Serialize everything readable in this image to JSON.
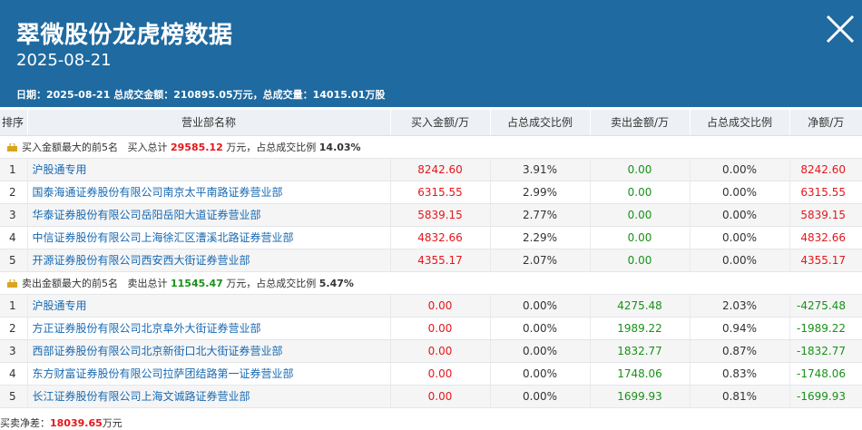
{
  "header": {
    "title": "翠微股份龙虎榜数据",
    "date": "2025-08-21",
    "summary": "日期：2025-08-21 总成交金额：210895.05万元，总成交量：14015.01万股"
  },
  "table": {
    "headers": [
      "排序",
      "营业部名称",
      "买入金额/万",
      "占总成交比例",
      "卖出金额/万",
      "占总成交比例",
      "净额/万"
    ],
    "buy_section": {
      "label": "买入金额最大的前5名",
      "total_prefix": "买入总计",
      "total": "29585.12",
      "unit_text": "万元，占总成交比例",
      "ratio": "14.03%"
    },
    "buy_rows": [
      {
        "rank": "1",
        "name": "沪股通专用",
        "buy": "8242.60",
        "buy_ratio": "3.91%",
        "sell": "0.00",
        "sell_ratio": "0.00%",
        "net": "8242.60"
      },
      {
        "rank": "2",
        "name": "国泰海通证券股份有限公司南京太平南路证券营业部",
        "buy": "6315.55",
        "buy_ratio": "2.99%",
        "sell": "0.00",
        "sell_ratio": "0.00%",
        "net": "6315.55"
      },
      {
        "rank": "3",
        "name": "华泰证券股份有限公司岳阳岳阳大道证券营业部",
        "buy": "5839.15",
        "buy_ratio": "2.77%",
        "sell": "0.00",
        "sell_ratio": "0.00%",
        "net": "5839.15"
      },
      {
        "rank": "4",
        "name": "中信证券股份有限公司上海徐汇区漕溪北路证券营业部",
        "buy": "4832.66",
        "buy_ratio": "2.29%",
        "sell": "0.00",
        "sell_ratio": "0.00%",
        "net": "4832.66"
      },
      {
        "rank": "5",
        "name": "开源证券股份有限公司西安西大街证券营业部",
        "buy": "4355.17",
        "buy_ratio": "2.07%",
        "sell": "0.00",
        "sell_ratio": "0.00%",
        "net": "4355.17"
      }
    ],
    "sell_section": {
      "label": "卖出金额最大的前5名",
      "total_prefix": "卖出总计",
      "total": "11545.47",
      "unit_text": "万元，占总成交比例",
      "ratio": "5.47%"
    },
    "sell_rows": [
      {
        "rank": "1",
        "name": "沪股通专用",
        "buy": "0.00",
        "buy_ratio": "0.00%",
        "sell": "4275.48",
        "sell_ratio": "2.03%",
        "net": "-4275.48"
      },
      {
        "rank": "2",
        "name": "方正证券股份有限公司北京阜外大街证券营业部",
        "buy": "0.00",
        "buy_ratio": "0.00%",
        "sell": "1989.22",
        "sell_ratio": "0.94%",
        "net": "-1989.22"
      },
      {
        "rank": "3",
        "name": "西部证券股份有限公司北京新街口北大街证券营业部",
        "buy": "0.00",
        "buy_ratio": "0.00%",
        "sell": "1832.77",
        "sell_ratio": "0.87%",
        "net": "-1832.77"
      },
      {
        "rank": "4",
        "name": "东方财富证券股份有限公司拉萨团结路第一证券营业部",
        "buy": "0.00",
        "buy_ratio": "0.00%",
        "sell": "1748.06",
        "sell_ratio": "0.83%",
        "net": "-1748.06"
      },
      {
        "rank": "5",
        "name": "长江证券股份有限公司上海文诚路证券营业部",
        "buy": "0.00",
        "buy_ratio": "0.00%",
        "sell": "1699.93",
        "sell_ratio": "0.81%",
        "net": "-1699.93"
      }
    ]
  },
  "footer": {
    "label": "买卖净差：",
    "value": "18039.65",
    "unit": "万元"
  },
  "icons": {
    "close": "close-icon",
    "section": "lock-icon"
  },
  "colors": {
    "header_bg": "#1f6aa0",
    "positive": "#e6161a",
    "negative": "#189218",
    "link": "#1769b2"
  }
}
